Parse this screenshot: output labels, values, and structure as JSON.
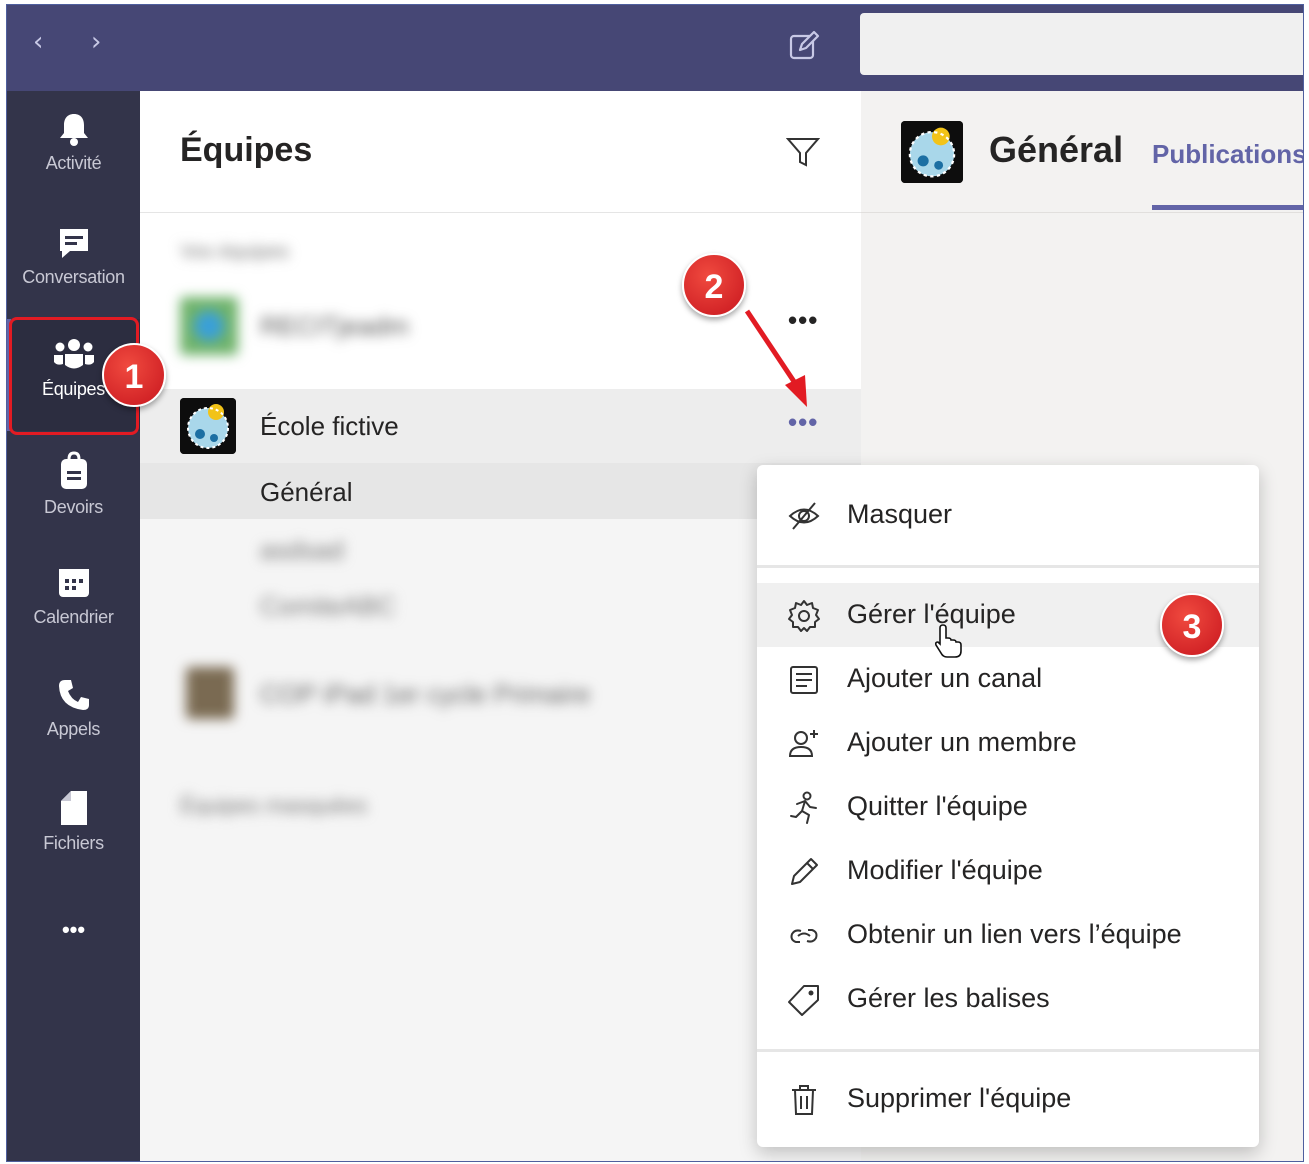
{
  "titlebar": {
    "back_glyph": "‹",
    "forward_glyph": "›",
    "compose_icon": "compose-icon"
  },
  "rail": {
    "items": [
      {
        "id": "activite",
        "label": "Activité",
        "icon": "bell-icon"
      },
      {
        "id": "conversation",
        "label": "Conversation",
        "icon": "chat-icon"
      },
      {
        "id": "equipes",
        "label": "Équipes",
        "icon": "teams-icon",
        "active": true
      },
      {
        "id": "devoirs",
        "label": "Devoirs",
        "icon": "assignments-icon"
      },
      {
        "id": "calendrier",
        "label": "Calendrier",
        "icon": "calendar-icon"
      },
      {
        "id": "appels",
        "label": "Appels",
        "icon": "phone-icon"
      },
      {
        "id": "fichiers",
        "label": "Fichiers",
        "icon": "file-icon"
      }
    ],
    "more_label": "•••"
  },
  "teams_panel": {
    "title": "Équipes",
    "blurred_section_label": "Vos équipes",
    "blurred_team": "RECITjeadm",
    "team": {
      "name": "École fictive"
    },
    "channels": [
      {
        "name": "Général",
        "selected": true
      },
      {
        "name": "asdsad",
        "blurred": true
      },
      {
        "name": "ComiteABC",
        "blurred": true
      }
    ],
    "blurred_team_2": "COP iPad 1er cycle Primaire",
    "hidden_teams_label": "Équipes masquées",
    "more_label": "•••"
  },
  "channel_header": {
    "title": "Général",
    "tab": "Publications"
  },
  "context_menu": {
    "items": [
      {
        "id": "masquer",
        "label": "Masquer",
        "icon": "hide-icon"
      },
      {
        "id": "gerer",
        "label": "Gérer l'équipe",
        "icon": "settings-gear-icon",
        "hover": true
      },
      {
        "id": "ajouter-canal",
        "label": "Ajouter un canal",
        "icon": "add-channel-icon"
      },
      {
        "id": "ajouter-membre",
        "label": "Ajouter un membre",
        "icon": "add-member-icon"
      },
      {
        "id": "quitter",
        "label": "Quitter l'équipe",
        "icon": "leave-icon"
      },
      {
        "id": "modifier",
        "label": "Modifier l'équipe",
        "icon": "pencil-icon"
      },
      {
        "id": "lien",
        "label": "Obtenir un lien vers l’équipe",
        "icon": "link-icon"
      },
      {
        "id": "balises",
        "label": "Gérer les balises",
        "icon": "tag-icon"
      },
      {
        "id": "supprimer",
        "label": "Supprimer l'équipe",
        "icon": "trash-icon"
      }
    ]
  },
  "annotations": {
    "step1": "1",
    "step2": "2",
    "step3": "3",
    "accent_color": "#6264a7",
    "callout_color": "#e21b23"
  }
}
